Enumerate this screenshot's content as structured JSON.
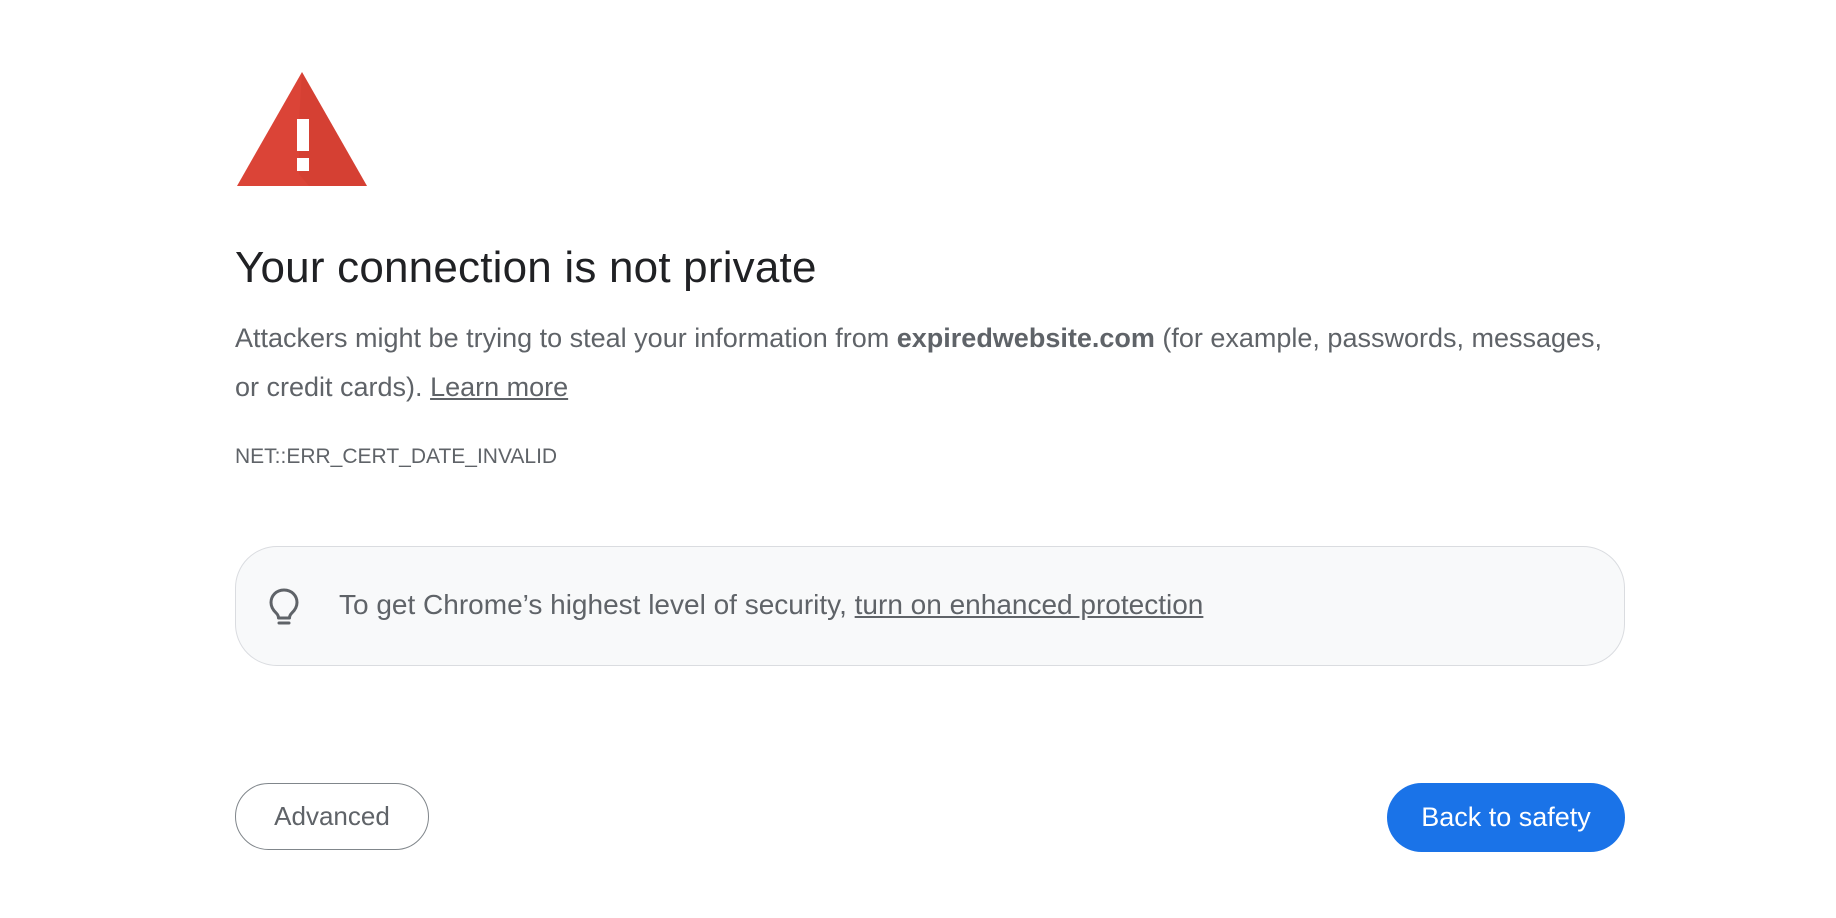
{
  "page": {
    "icon": "warning-triangle-icon",
    "title": "Your connection is not private",
    "description": {
      "before_domain": "Attackers might be trying to steal your information from ",
      "domain": "expiredwebsite.com",
      "after_domain": " (for example, passwords, messages, or credit cards). ",
      "learn_more": "Learn more"
    },
    "error_code": "NET::ERR_CERT_DATE_INVALID"
  },
  "protection": {
    "icon": "lightbulb-icon",
    "text": "To get Chrome’s highest level of security, ",
    "link": "turn on enhanced protection"
  },
  "buttons": {
    "advanced": "Advanced",
    "back_to_safety": "Back to safety"
  },
  "colors": {
    "warning_red": "#db4437",
    "primary_blue": "#1a73e8",
    "title_text": "#202124",
    "body_text": "#5f6368",
    "box_background": "#f8f9fa",
    "box_border": "#dadce0"
  }
}
